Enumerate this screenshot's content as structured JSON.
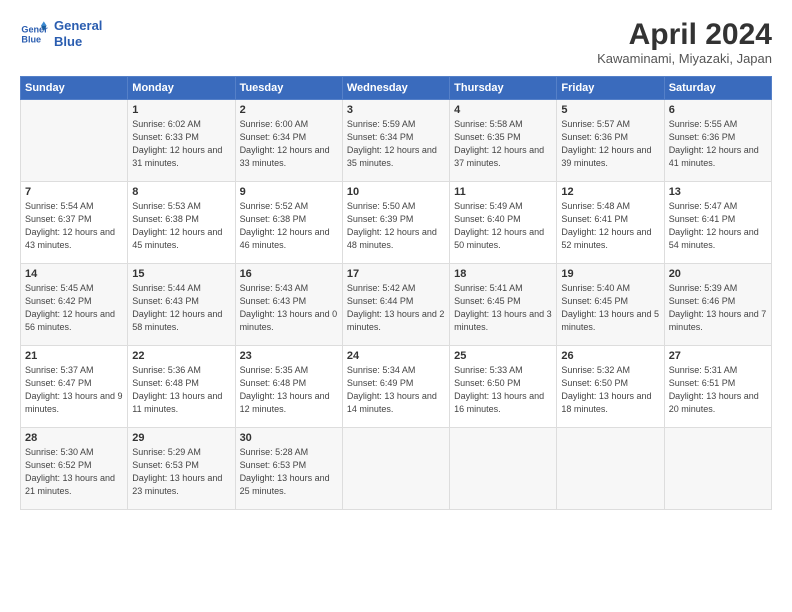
{
  "header": {
    "logo_line1": "General",
    "logo_line2": "Blue",
    "month_title": "April 2024",
    "location": "Kawaminami, Miyazaki, Japan"
  },
  "weekdays": [
    "Sunday",
    "Monday",
    "Tuesday",
    "Wednesday",
    "Thursday",
    "Friday",
    "Saturday"
  ],
  "weeks": [
    [
      {
        "day": "",
        "sunrise": "",
        "sunset": "",
        "daylight": ""
      },
      {
        "day": "1",
        "sunrise": "Sunrise: 6:02 AM",
        "sunset": "Sunset: 6:33 PM",
        "daylight": "Daylight: 12 hours and 31 minutes."
      },
      {
        "day": "2",
        "sunrise": "Sunrise: 6:00 AM",
        "sunset": "Sunset: 6:34 PM",
        "daylight": "Daylight: 12 hours and 33 minutes."
      },
      {
        "day": "3",
        "sunrise": "Sunrise: 5:59 AM",
        "sunset": "Sunset: 6:34 PM",
        "daylight": "Daylight: 12 hours and 35 minutes."
      },
      {
        "day": "4",
        "sunrise": "Sunrise: 5:58 AM",
        "sunset": "Sunset: 6:35 PM",
        "daylight": "Daylight: 12 hours and 37 minutes."
      },
      {
        "day": "5",
        "sunrise": "Sunrise: 5:57 AM",
        "sunset": "Sunset: 6:36 PM",
        "daylight": "Daylight: 12 hours and 39 minutes."
      },
      {
        "day": "6",
        "sunrise": "Sunrise: 5:55 AM",
        "sunset": "Sunset: 6:36 PM",
        "daylight": "Daylight: 12 hours and 41 minutes."
      }
    ],
    [
      {
        "day": "7",
        "sunrise": "Sunrise: 5:54 AM",
        "sunset": "Sunset: 6:37 PM",
        "daylight": "Daylight: 12 hours and 43 minutes."
      },
      {
        "day": "8",
        "sunrise": "Sunrise: 5:53 AM",
        "sunset": "Sunset: 6:38 PM",
        "daylight": "Daylight: 12 hours and 45 minutes."
      },
      {
        "day": "9",
        "sunrise": "Sunrise: 5:52 AM",
        "sunset": "Sunset: 6:38 PM",
        "daylight": "Daylight: 12 hours and 46 minutes."
      },
      {
        "day": "10",
        "sunrise": "Sunrise: 5:50 AM",
        "sunset": "Sunset: 6:39 PM",
        "daylight": "Daylight: 12 hours and 48 minutes."
      },
      {
        "day": "11",
        "sunrise": "Sunrise: 5:49 AM",
        "sunset": "Sunset: 6:40 PM",
        "daylight": "Daylight: 12 hours and 50 minutes."
      },
      {
        "day": "12",
        "sunrise": "Sunrise: 5:48 AM",
        "sunset": "Sunset: 6:41 PM",
        "daylight": "Daylight: 12 hours and 52 minutes."
      },
      {
        "day": "13",
        "sunrise": "Sunrise: 5:47 AM",
        "sunset": "Sunset: 6:41 PM",
        "daylight": "Daylight: 12 hours and 54 minutes."
      }
    ],
    [
      {
        "day": "14",
        "sunrise": "Sunrise: 5:45 AM",
        "sunset": "Sunset: 6:42 PM",
        "daylight": "Daylight: 12 hours and 56 minutes."
      },
      {
        "day": "15",
        "sunrise": "Sunrise: 5:44 AM",
        "sunset": "Sunset: 6:43 PM",
        "daylight": "Daylight: 12 hours and 58 minutes."
      },
      {
        "day": "16",
        "sunrise": "Sunrise: 5:43 AM",
        "sunset": "Sunset: 6:43 PM",
        "daylight": "Daylight: 13 hours and 0 minutes."
      },
      {
        "day": "17",
        "sunrise": "Sunrise: 5:42 AM",
        "sunset": "Sunset: 6:44 PM",
        "daylight": "Daylight: 13 hours and 2 minutes."
      },
      {
        "day": "18",
        "sunrise": "Sunrise: 5:41 AM",
        "sunset": "Sunset: 6:45 PM",
        "daylight": "Daylight: 13 hours and 3 minutes."
      },
      {
        "day": "19",
        "sunrise": "Sunrise: 5:40 AM",
        "sunset": "Sunset: 6:45 PM",
        "daylight": "Daylight: 13 hours and 5 minutes."
      },
      {
        "day": "20",
        "sunrise": "Sunrise: 5:39 AM",
        "sunset": "Sunset: 6:46 PM",
        "daylight": "Daylight: 13 hours and 7 minutes."
      }
    ],
    [
      {
        "day": "21",
        "sunrise": "Sunrise: 5:37 AM",
        "sunset": "Sunset: 6:47 PM",
        "daylight": "Daylight: 13 hours and 9 minutes."
      },
      {
        "day": "22",
        "sunrise": "Sunrise: 5:36 AM",
        "sunset": "Sunset: 6:48 PM",
        "daylight": "Daylight: 13 hours and 11 minutes."
      },
      {
        "day": "23",
        "sunrise": "Sunrise: 5:35 AM",
        "sunset": "Sunset: 6:48 PM",
        "daylight": "Daylight: 13 hours and 12 minutes."
      },
      {
        "day": "24",
        "sunrise": "Sunrise: 5:34 AM",
        "sunset": "Sunset: 6:49 PM",
        "daylight": "Daylight: 13 hours and 14 minutes."
      },
      {
        "day": "25",
        "sunrise": "Sunrise: 5:33 AM",
        "sunset": "Sunset: 6:50 PM",
        "daylight": "Daylight: 13 hours and 16 minutes."
      },
      {
        "day": "26",
        "sunrise": "Sunrise: 5:32 AM",
        "sunset": "Sunset: 6:50 PM",
        "daylight": "Daylight: 13 hours and 18 minutes."
      },
      {
        "day": "27",
        "sunrise": "Sunrise: 5:31 AM",
        "sunset": "Sunset: 6:51 PM",
        "daylight": "Daylight: 13 hours and 20 minutes."
      }
    ],
    [
      {
        "day": "28",
        "sunrise": "Sunrise: 5:30 AM",
        "sunset": "Sunset: 6:52 PM",
        "daylight": "Daylight: 13 hours and 21 minutes."
      },
      {
        "day": "29",
        "sunrise": "Sunrise: 5:29 AM",
        "sunset": "Sunset: 6:53 PM",
        "daylight": "Daylight: 13 hours and 23 minutes."
      },
      {
        "day": "30",
        "sunrise": "Sunrise: 5:28 AM",
        "sunset": "Sunset: 6:53 PM",
        "daylight": "Daylight: 13 hours and 25 minutes."
      },
      {
        "day": "",
        "sunrise": "",
        "sunset": "",
        "daylight": ""
      },
      {
        "day": "",
        "sunrise": "",
        "sunset": "",
        "daylight": ""
      },
      {
        "day": "",
        "sunrise": "",
        "sunset": "",
        "daylight": ""
      },
      {
        "day": "",
        "sunrise": "",
        "sunset": "",
        "daylight": ""
      }
    ]
  ]
}
